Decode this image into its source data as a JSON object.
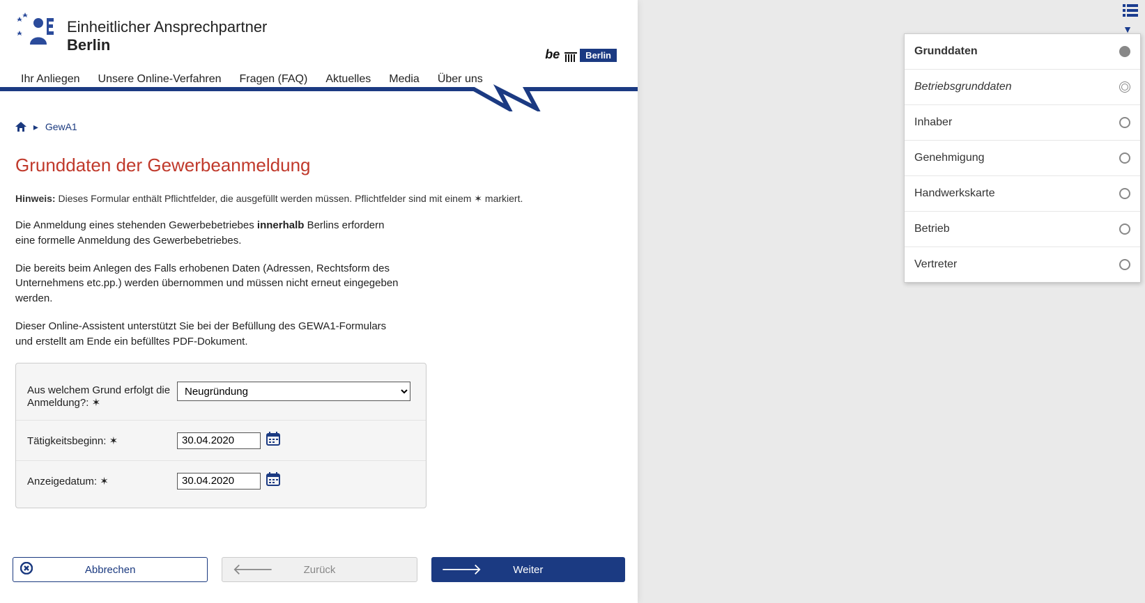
{
  "header": {
    "title1": "Einheitlicher Ansprechpartner",
    "title2": "Berlin"
  },
  "nav": [
    "Ihr Anliegen",
    "Unsere Online-Verfahren",
    "Fragen (FAQ)",
    "Aktuelles",
    "Media",
    "Über uns"
  ],
  "belogo": {
    "prefix": "be",
    "box": "Berlin"
  },
  "breadcrumb": {
    "item": "GewA1"
  },
  "page": {
    "heading": "Grunddaten der Gewerbeanmeldung",
    "hint_label": "Hinweis:",
    "hint_text": "Dieses Formular enthält Pflichtfelder, die ausgefüllt werden müssen. Pflichtfelder sind mit einem ✶ markiert.",
    "p1a": "Die Anmeldung eines stehenden Gewerbebetriebes ",
    "p1b": "innerhalb",
    "p1c": " Berlins erfordern eine formelle Anmeldung des Gewerbebetriebes.",
    "p2": "Die bereits beim Anlegen des Falls erhobenen Daten (Adressen, Rechtsform des Unternehmens etc.pp.) werden übernommen und müssen nicht erneut eingegeben werden.",
    "p3": "Dieser Online-Assistent unterstützt Sie bei der Befüllung des GEWA1-Formulars und erstellt am Ende ein befülltes PDF-Dokument."
  },
  "form": {
    "reason_label": "Aus welchem Grund erfolgt die Anmeldung?: ✶",
    "reason_value": "Neugründung",
    "start_label": "Tätigkeitsbeginn: ✶",
    "start_value": "30.04.2020",
    "display_label": "Anzeigedatum: ✶",
    "display_value": "30.04.2020"
  },
  "buttons": {
    "cancel": "Abbrechen",
    "back": "Zurück",
    "next": "Weiter"
  },
  "side": {
    "header": "Grunddaten",
    "items": [
      {
        "label": "Betriebsgrunddaten",
        "state": "current"
      },
      {
        "label": "Inhaber",
        "state": "empty"
      },
      {
        "label": "Genehmigung",
        "state": "empty"
      },
      {
        "label": "Handwerkskarte",
        "state": "empty"
      },
      {
        "label": "Betrieb",
        "state": "empty"
      },
      {
        "label": "Vertreter",
        "state": "empty"
      }
    ]
  }
}
